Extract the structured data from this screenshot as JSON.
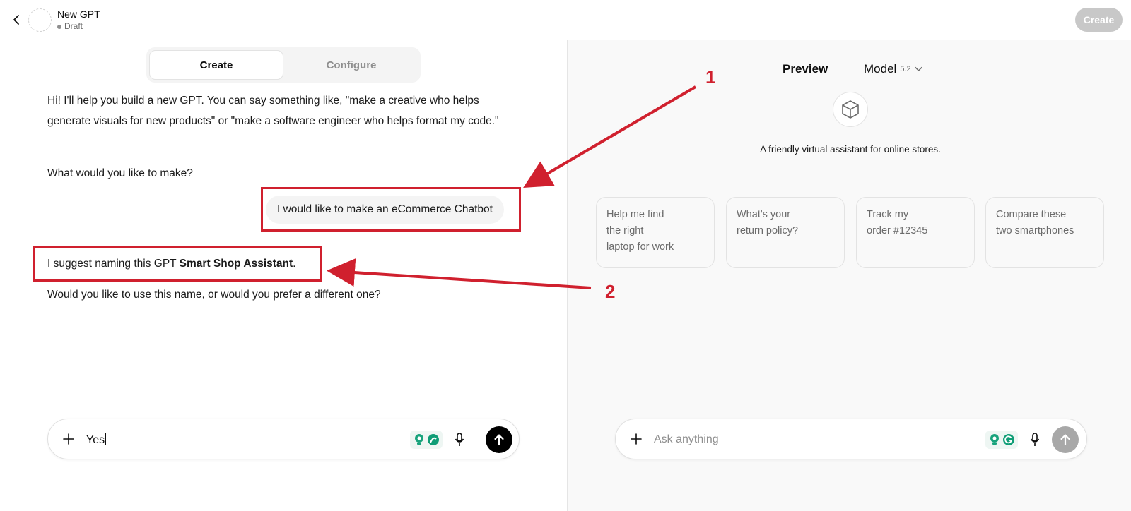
{
  "header": {
    "title": "New GPT",
    "status": "Draft",
    "create_button": "Create"
  },
  "tabs": [
    {
      "label": "Create",
      "active": true
    },
    {
      "label": "Configure",
      "active": false
    }
  ],
  "conversation": {
    "intro": "Hi! I'll help you build a new GPT. You can say something like, \"make a creative who helps generate visuals for new products\" or \"make a software engineer who helps format my code.\"",
    "question": "What would you like to make?",
    "user_message": "I would like to make an eCommerce Chatbot",
    "suggest_prefix": "I suggest naming this GPT ",
    "suggest_name": "Smart Shop Assistant",
    "suggest_suffix": ".",
    "follow_up": "Would you like to use this name, or would you prefer a different one?"
  },
  "composer_left": {
    "value": "Yes"
  },
  "preview": {
    "label": "Preview",
    "model_label": "Model",
    "model_version": "5.2",
    "description": "A friendly virtual assistant for online stores.",
    "starters": [
      {
        "lines": [
          "Help me find",
          "the right",
          "laptop for work"
        ]
      },
      {
        "lines": [
          "What's your",
          "return policy?"
        ]
      },
      {
        "lines": [
          "Track my",
          "order #12345"
        ]
      },
      {
        "lines": [
          "Compare these",
          "two smartphones"
        ]
      }
    ],
    "composer_placeholder": "Ask anything"
  },
  "annotations": {
    "label_1": "1",
    "label_2": "2",
    "color": "#d0202e"
  },
  "colors": {
    "send_active": "#000000",
    "send_disabled": "#a8a8a8",
    "create_disabled": "#c8c8c8"
  }
}
